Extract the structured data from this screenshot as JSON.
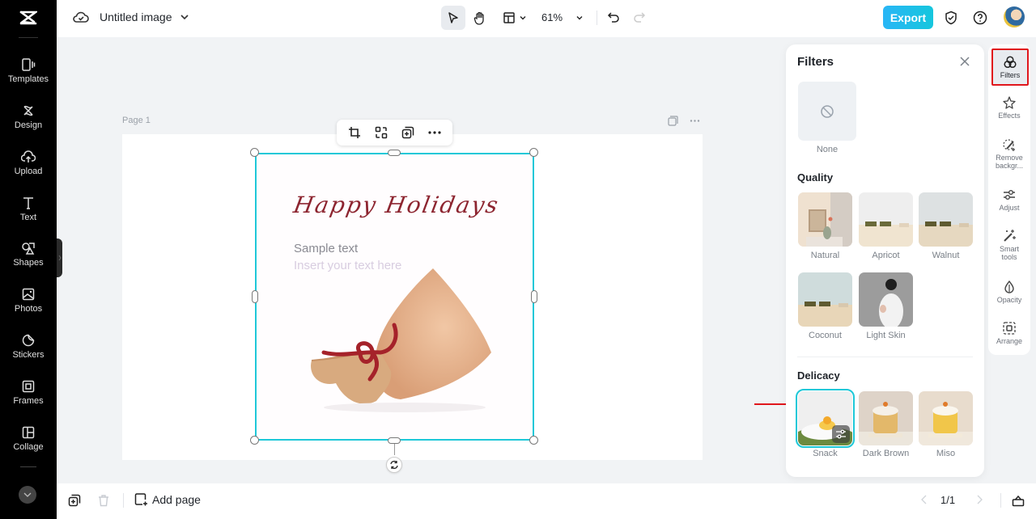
{
  "app": {
    "title": "Untitled image",
    "zoom": "61%"
  },
  "toolbar": {
    "export_label": "Export",
    "tools": [
      "select",
      "hand",
      "layout",
      "undo",
      "redo"
    ]
  },
  "sidebar": {
    "items": [
      {
        "label": "Templates",
        "icon": "templates-icon"
      },
      {
        "label": "Design",
        "icon": "design-icon"
      },
      {
        "label": "Upload",
        "icon": "upload-icon"
      },
      {
        "label": "Text",
        "icon": "text-icon"
      },
      {
        "label": "Shapes",
        "icon": "shapes-icon"
      },
      {
        "label": "Photos",
        "icon": "photos-icon"
      },
      {
        "label": "Stickers",
        "icon": "stickers-icon"
      },
      {
        "label": "Frames",
        "icon": "frames-icon"
      },
      {
        "label": "Collage",
        "icon": "collage-icon"
      }
    ]
  },
  "canvas": {
    "page_label": "Page 1",
    "artwork": {
      "headline": "Happy Holidays",
      "sample_text": "Sample text",
      "placeholder_text": "Insert your text here"
    }
  },
  "bottom": {
    "add_page_label": "Add page",
    "pager": "1/1"
  },
  "filters_panel": {
    "title": "Filters",
    "none_label": "None",
    "sections": [
      {
        "title": "Quality",
        "items": [
          {
            "label": "Natural"
          },
          {
            "label": "Apricot"
          },
          {
            "label": "Walnut"
          },
          {
            "label": "Coconut"
          },
          {
            "label": "Light Skin"
          }
        ]
      },
      {
        "title": "Delicacy",
        "items": [
          {
            "label": "Snack",
            "selected": true
          },
          {
            "label": "Dark Brown"
          },
          {
            "label": "Miso"
          }
        ]
      }
    ]
  },
  "rail": {
    "items": [
      {
        "label": "Filters",
        "active": true
      },
      {
        "label": "Effects"
      },
      {
        "label": "Remove backgr..."
      },
      {
        "label": "Adjust"
      },
      {
        "label": "Smart tools"
      },
      {
        "label": "Opacity"
      },
      {
        "label": "Arrange"
      }
    ]
  },
  "colors": {
    "accent": "#1ec8d8",
    "export": "#29b6f6",
    "highlight": "#e0161c"
  }
}
